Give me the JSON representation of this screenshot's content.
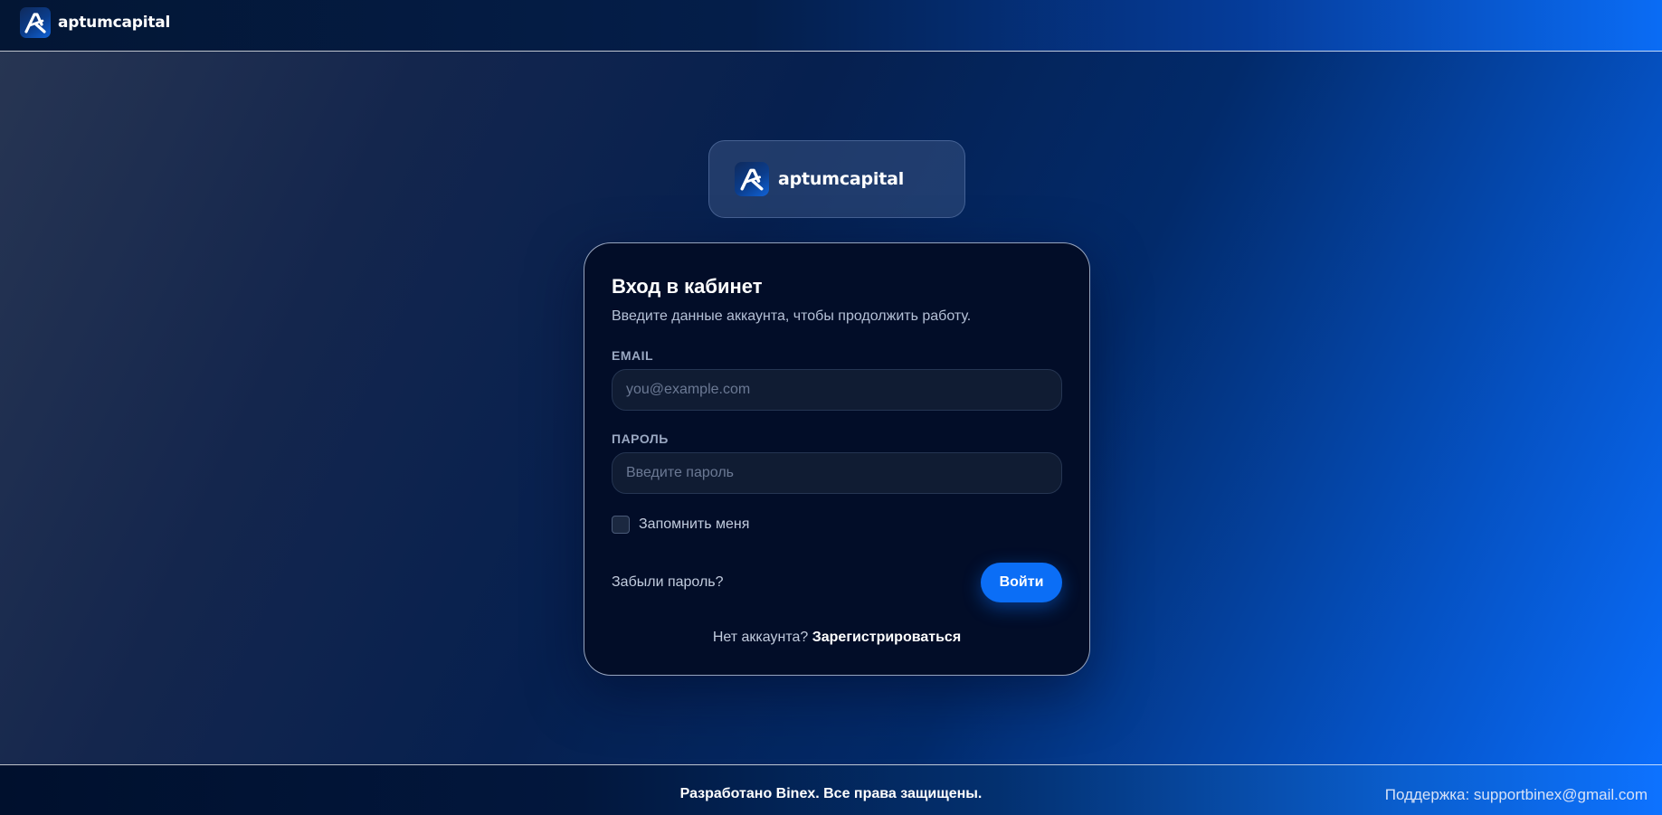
{
  "header": {
    "brand": "aptumcapital",
    "logo_icon": "aptum-logo-icon"
  },
  "brand_card": {
    "brand": "aptumcapital",
    "logo_icon": "aptum-logo-icon"
  },
  "login": {
    "title": "Вход в кабинет",
    "subtitle": "Введите данные аккаунта, чтобы продолжить работу.",
    "email_label": "EMAIL",
    "email_value": "",
    "email_placeholder": "you@example.com",
    "password_label": "ПАРОЛЬ",
    "password_value": "",
    "password_placeholder": "Введите пароль",
    "remember_label": "Запомнить меня",
    "remember_checked": false,
    "forgot_label": "Забыли пароль?",
    "submit_label": "Войти",
    "signup_prompt": "Нет аккаунта?",
    "signup_link": "Зарегистрироваться"
  },
  "footer": {
    "copyright": "Разработано Binex. Все права защищены.",
    "support": "Поддержка: supportbinex@gmail.com"
  },
  "colors": {
    "accent": "#0b6ef6",
    "card_background": "#020d28",
    "input_background": "#101c33"
  }
}
